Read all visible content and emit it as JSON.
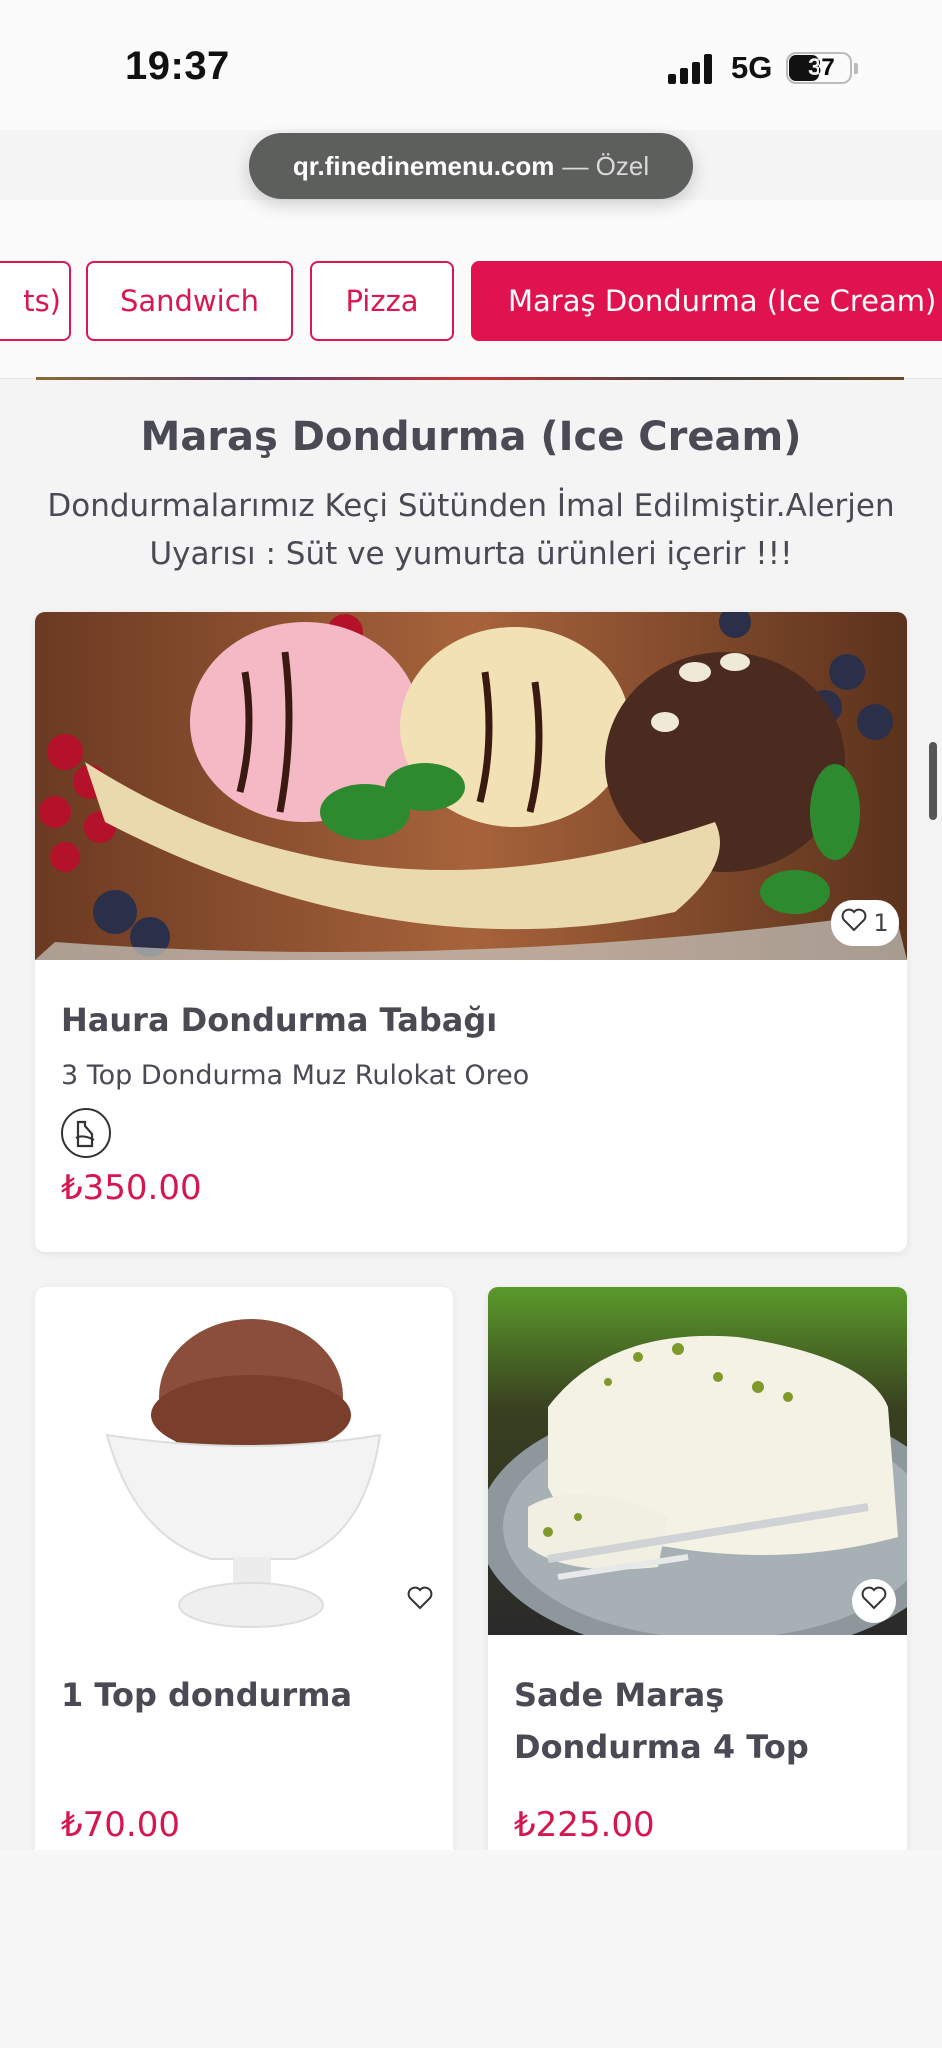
{
  "status_bar": {
    "time": "19:37",
    "network": "5G",
    "battery": "37"
  },
  "browser": {
    "url_host": "qr.finedinemenu.com",
    "url_mode": "— Özel"
  },
  "tabs": [
    {
      "label": "ts)"
    },
    {
      "label": "Sandwich"
    },
    {
      "label": "Pizza"
    },
    {
      "label": "Maraş Dondurma (Ice Cream)"
    }
  ],
  "section": {
    "title": "Maraş Dondurma (Ice Cream)",
    "description": "Dondurmalarımız Keçi Sütünden İmal Edilmiştir.Alerjen Uyarısı : Süt ve yumurta ürünleri içerir !!!"
  },
  "items": [
    {
      "name": "Haura Dondurma Tabağı",
      "description": "3 Top Dondurma Muz Rulokat Oreo",
      "price": "₺350.00",
      "likes": "1",
      "allergen_icon": "milk-allergen-icon"
    },
    {
      "name": "1 Top dondurma",
      "price": "₺70.00",
      "likes": ""
    },
    {
      "name": "Sade Maraş Dondurma 4 Top",
      "price": "₺225.00",
      "likes": ""
    }
  ],
  "colors": {
    "accent": "#e0134f",
    "price": "#d6164e",
    "text": "#4a4a55"
  }
}
